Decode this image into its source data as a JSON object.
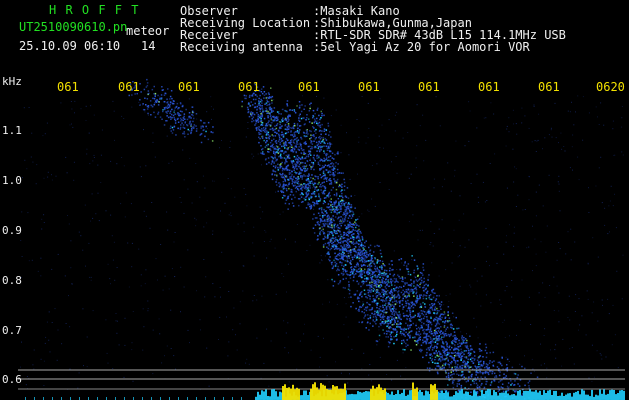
{
  "header": {
    "software": "H R O F F T",
    "filename": "UT2510090610.pn",
    "meteor_label": "meteor",
    "date_time": "25.10.09 06:10",
    "count": "14",
    "fields": [
      {
        "label": "Observer",
        "value": ":Masaki Kano"
      },
      {
        "label": "Receiving Location",
        "value": ":Shibukawa,Gunma,Japan"
      },
      {
        "label": "Receiver",
        "value": ":RTL-SDR SDR# 43dB L15 114.1MHz USB"
      },
      {
        "label": "Receiving antenna",
        "value": ":5el Yagi Az 20 for Aomori VOR"
      }
    ]
  },
  "axis": {
    "unit": "kHz",
    "y_ticks": [
      "1.1",
      "1.0",
      "0.9",
      "0.8",
      "0.7",
      "0.6"
    ],
    "x_ticks": [
      "061",
      "061",
      "061",
      "061",
      "061",
      "061",
      "061",
      "061",
      "061",
      "0620"
    ]
  },
  "colors": {
    "background": "#000000",
    "header_green": "#22e022",
    "tick_yellow": "#f2e000",
    "signal_blue": "#2a55d8",
    "signal_cyan": "#20d0ff",
    "signal_yellow": "#f2e000"
  }
}
